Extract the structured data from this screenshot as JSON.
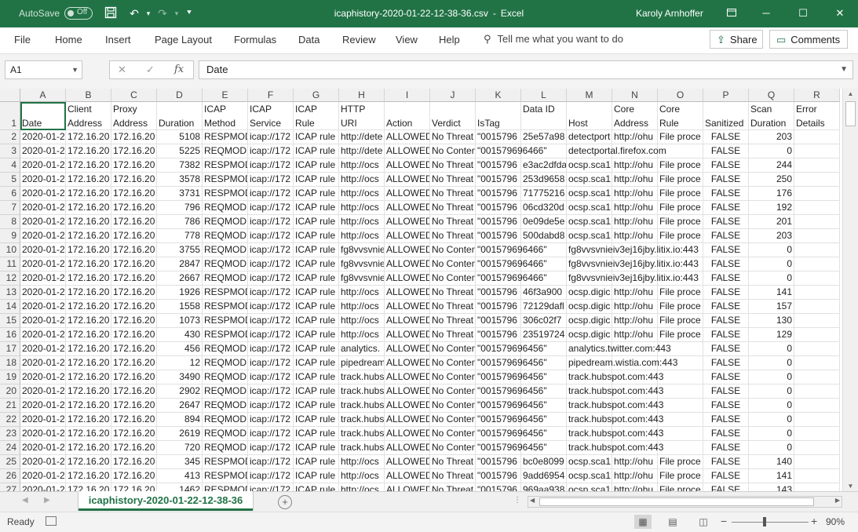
{
  "titlebar": {
    "autosave_label": "AutoSave",
    "autosave_state": "Off",
    "file_name": "icaphistory-2020-01-22-12-38-36.csv",
    "separator": "-",
    "app_name": "Excel",
    "user_name": "Karoly Arnhoffer",
    "bg_color": "#217346"
  },
  "menu": {
    "items": [
      "File",
      "Home",
      "Insert",
      "Page Layout",
      "Formulas",
      "Data",
      "Review",
      "View",
      "Help"
    ],
    "tell_me": "Tell me what you want to do",
    "share": "Share",
    "comments": "Comments"
  },
  "formula_bar": {
    "name_box": "A1",
    "fx_label": "fx",
    "content": "Date"
  },
  "grid": {
    "columns": [
      "A",
      "B",
      "C",
      "D",
      "E",
      "F",
      "G",
      "H",
      "I",
      "J",
      "K",
      "L",
      "M",
      "N",
      "O",
      "P",
      "Q",
      "R"
    ],
    "headers": [
      "Date",
      "Client Address",
      "Proxy Address",
      "Duration",
      "ICAP Method",
      "ICAP Service",
      "ICAP Rule",
      "HTTP URI",
      "Action",
      "Verdict",
      "IsTag",
      "Data ID",
      "Host",
      "Core Address",
      "Core Rule",
      "Sanitized",
      "Scan Duration",
      "Error Details"
    ],
    "rows": [
      {
        "n": "2",
        "A": "2020-01-2",
        "B": "172.16.20",
        "C": "172.16.20",
        "D": "5108",
        "E": "RESPMOD",
        "F": "icap://172",
        "G": "ICAP rule",
        "H": "http://dete",
        "I": "ALLOWED",
        "J": "No Threat",
        "K": "\"0015796",
        "L": "25e57a98",
        "M": "detectport",
        "N": "http://ohu",
        "O": "File proce",
        "P": "FALSE",
        "Q": "203",
        "R": ""
      },
      {
        "n": "3",
        "A": "2020-01-2",
        "B": "172.16.20",
        "C": "172.16.20",
        "D": "5225",
        "E": "REQMOD",
        "F": "icap://172",
        "G": "ICAP rule",
        "H": "http://dete",
        "I": "ALLOWED",
        "J": "No Conten",
        "K": "\"001579696466\"",
        "L": "",
        "M": "detectportal.firefox.com",
        "N": "",
        "O": "",
        "P": "FALSE",
        "Q": "0",
        "R": ""
      },
      {
        "n": "4",
        "A": "2020-01-2",
        "B": "172.16.20",
        "C": "172.16.20",
        "D": "7382",
        "E": "RESPMOD",
        "F": "icap://172",
        "G": "ICAP rule",
        "H": "http://ocs",
        "I": "ALLOWED",
        "J": "No Threat",
        "K": "\"0015796",
        "L": "e3ac2dfda",
        "M": "ocsp.sca1",
        "N": "http://ohu",
        "O": "File proce",
        "P": "FALSE",
        "Q": "244",
        "R": ""
      },
      {
        "n": "5",
        "A": "2020-01-2",
        "B": "172.16.20",
        "C": "172.16.20",
        "D": "3578",
        "E": "RESPMOD",
        "F": "icap://172",
        "G": "ICAP rule",
        "H": "http://ocs",
        "I": "ALLOWED",
        "J": "No Threat",
        "K": "\"0015796",
        "L": "253d9658",
        "M": "ocsp.sca1",
        "N": "http://ohu",
        "O": "File proce",
        "P": "FALSE",
        "Q": "250",
        "R": ""
      },
      {
        "n": "6",
        "A": "2020-01-2",
        "B": "172.16.20",
        "C": "172.16.20",
        "D": "3731",
        "E": "RESPMOD",
        "F": "icap://172",
        "G": "ICAP rule",
        "H": "http://ocs",
        "I": "ALLOWED",
        "J": "No Threat",
        "K": "\"0015796",
        "L": "71775216",
        "M": "ocsp.sca1",
        "N": "http://ohu",
        "O": "File proce",
        "P": "FALSE",
        "Q": "176",
        "R": ""
      },
      {
        "n": "7",
        "A": "2020-01-2",
        "B": "172.16.20",
        "C": "172.16.20",
        "D": "796",
        "E": "REQMOD",
        "F": "icap://172",
        "G": "ICAP rule",
        "H": "http://ocs",
        "I": "ALLOWED",
        "J": "No Threat",
        "K": "\"0015796",
        "L": "06cd320d",
        "M": "ocsp.sca1",
        "N": "http://ohu",
        "O": "File proce",
        "P": "FALSE",
        "Q": "192",
        "R": ""
      },
      {
        "n": "8",
        "A": "2020-01-2",
        "B": "172.16.20",
        "C": "172.16.20",
        "D": "786",
        "E": "REQMOD",
        "F": "icap://172",
        "G": "ICAP rule",
        "H": "http://ocs",
        "I": "ALLOWED",
        "J": "No Threat",
        "K": "\"0015796",
        "L": "0e09de5e",
        "M": "ocsp.sca1",
        "N": "http://ohu",
        "O": "File proce",
        "P": "FALSE",
        "Q": "201",
        "R": ""
      },
      {
        "n": "9",
        "A": "2020-01-2",
        "B": "172.16.20",
        "C": "172.16.20",
        "D": "778",
        "E": "REQMOD",
        "F": "icap://172",
        "G": "ICAP rule",
        "H": "http://ocs",
        "I": "ALLOWED",
        "J": "No Threat",
        "K": "\"0015796",
        "L": "500dabd8",
        "M": "ocsp.sca1",
        "N": "http://ohu",
        "O": "File proce",
        "P": "FALSE",
        "Q": "203",
        "R": ""
      },
      {
        "n": "10",
        "A": "2020-01-2",
        "B": "172.16.20",
        "C": "172.16.20",
        "D": "3755",
        "E": "REQMOD",
        "F": "icap://172",
        "G": "ICAP rule",
        "H": "fg8vvsvnie",
        "I": "ALLOWED",
        "J": "No Conten",
        "K": "\"001579696466\"",
        "L": "",
        "M": "fg8vvsvnieiv3ej16jby.litix.io:443",
        "N": "",
        "O": "",
        "P": "FALSE",
        "Q": "0",
        "R": ""
      },
      {
        "n": "11",
        "A": "2020-01-2",
        "B": "172.16.20",
        "C": "172.16.20",
        "D": "2847",
        "E": "REQMOD",
        "F": "icap://172",
        "G": "ICAP rule",
        "H": "fg8vvsvnie",
        "I": "ALLOWED",
        "J": "No Conten",
        "K": "\"001579696466\"",
        "L": "",
        "M": "fg8vvsvnieiv3ej16jby.litix.io:443",
        "N": "",
        "O": "",
        "P": "FALSE",
        "Q": "0",
        "R": ""
      },
      {
        "n": "12",
        "A": "2020-01-2",
        "B": "172.16.20",
        "C": "172.16.20",
        "D": "2667",
        "E": "REQMOD",
        "F": "icap://172",
        "G": "ICAP rule",
        "H": "fg8vvsvnie",
        "I": "ALLOWED",
        "J": "No Conten",
        "K": "\"001579696466\"",
        "L": "",
        "M": "fg8vvsvnieiv3ej16jby.litix.io:443",
        "N": "",
        "O": "",
        "P": "FALSE",
        "Q": "0",
        "R": ""
      },
      {
        "n": "13",
        "A": "2020-01-2",
        "B": "172.16.20",
        "C": "172.16.20",
        "D": "1926",
        "E": "RESPMOD",
        "F": "icap://172",
        "G": "ICAP rule",
        "H": "http://ocs",
        "I": "ALLOWED",
        "J": "No Threat",
        "K": "\"0015796",
        "L": "46f3a900",
        "M": "ocsp.digic",
        "N": "http://ohu",
        "O": "File proce",
        "P": "FALSE",
        "Q": "141",
        "R": ""
      },
      {
        "n": "14",
        "A": "2020-01-2",
        "B": "172.16.20",
        "C": "172.16.20",
        "D": "1558",
        "E": "RESPMOD",
        "F": "icap://172",
        "G": "ICAP rule",
        "H": "http://ocs",
        "I": "ALLOWED",
        "J": "No Threat",
        "K": "\"0015796",
        "L": "72129dafl",
        "M": "ocsp.digic",
        "N": "http://ohu",
        "O": "File proce",
        "P": "FALSE",
        "Q": "157",
        "R": ""
      },
      {
        "n": "15",
        "A": "2020-01-2",
        "B": "172.16.20",
        "C": "172.16.20",
        "D": "1073",
        "E": "RESPMOD",
        "F": "icap://172",
        "G": "ICAP rule",
        "H": "http://ocs",
        "I": "ALLOWED",
        "J": "No Threat",
        "K": "\"0015796",
        "L": "306c02f7",
        "M": "ocsp.digic",
        "N": "http://ohu",
        "O": "File proce",
        "P": "FALSE",
        "Q": "130",
        "R": ""
      },
      {
        "n": "16",
        "A": "2020-01-2",
        "B": "172.16.20",
        "C": "172.16.20",
        "D": "430",
        "E": "RESPMOD",
        "F": "icap://172",
        "G": "ICAP rule",
        "H": "http://ocs",
        "I": "ALLOWED",
        "J": "No Threat",
        "K": "\"0015796",
        "L": "23519724",
        "M": "ocsp.digic",
        "N": "http://ohu",
        "O": "File proce",
        "P": "FALSE",
        "Q": "129",
        "R": ""
      },
      {
        "n": "17",
        "A": "2020-01-2",
        "B": "172.16.20",
        "C": "172.16.20",
        "D": "456",
        "E": "REQMOD",
        "F": "icap://172",
        "G": "ICAP rule",
        "H": "analytics.",
        "I": "ALLOWED",
        "J": "No Conten",
        "K": "\"001579696456\"",
        "L": "",
        "M": "analytics.twitter.com:443",
        "N": "",
        "O": "",
        "P": "FALSE",
        "Q": "0",
        "R": ""
      },
      {
        "n": "18",
        "A": "2020-01-2",
        "B": "172.16.20",
        "C": "172.16.20",
        "D": "12",
        "E": "REQMOD",
        "F": "icap://172",
        "G": "ICAP rule",
        "H": "pipedream",
        "I": "ALLOWED",
        "J": "No Conten",
        "K": "\"001579696456\"",
        "L": "",
        "M": "pipedream.wistia.com:443",
        "N": "",
        "O": "",
        "P": "FALSE",
        "Q": "0",
        "R": ""
      },
      {
        "n": "19",
        "A": "2020-01-2",
        "B": "172.16.20",
        "C": "172.16.20",
        "D": "3490",
        "E": "REQMOD",
        "F": "icap://172",
        "G": "ICAP rule",
        "H": "track.hubs",
        "I": "ALLOWED",
        "J": "No Conten",
        "K": "\"001579696456\"",
        "L": "",
        "M": "track.hubspot.com:443",
        "N": "",
        "O": "",
        "P": "FALSE",
        "Q": "0",
        "R": ""
      },
      {
        "n": "20",
        "A": "2020-01-2",
        "B": "172.16.20",
        "C": "172.16.20",
        "D": "2902",
        "E": "REQMOD",
        "F": "icap://172",
        "G": "ICAP rule",
        "H": "track.hubs",
        "I": "ALLOWED",
        "J": "No Conten",
        "K": "\"001579696456\"",
        "L": "",
        "M": "track.hubspot.com:443",
        "N": "",
        "O": "",
        "P": "FALSE",
        "Q": "0",
        "R": ""
      },
      {
        "n": "21",
        "A": "2020-01-2",
        "B": "172.16.20",
        "C": "172.16.20",
        "D": "2647",
        "E": "REQMOD",
        "F": "icap://172",
        "G": "ICAP rule",
        "H": "track.hubs",
        "I": "ALLOWED",
        "J": "No Conten",
        "K": "\"001579696456\"",
        "L": "",
        "M": "track.hubspot.com:443",
        "N": "",
        "O": "",
        "P": "FALSE",
        "Q": "0",
        "R": ""
      },
      {
        "n": "22",
        "A": "2020-01-2",
        "B": "172.16.20",
        "C": "172.16.20",
        "D": "894",
        "E": "REQMOD",
        "F": "icap://172",
        "G": "ICAP rule",
        "H": "track.hubs",
        "I": "ALLOWED",
        "J": "No Conten",
        "K": "\"001579696456\"",
        "L": "",
        "M": "track.hubspot.com:443",
        "N": "",
        "O": "",
        "P": "FALSE",
        "Q": "0",
        "R": ""
      },
      {
        "n": "23",
        "A": "2020-01-2",
        "B": "172.16.20",
        "C": "172.16.20",
        "D": "2619",
        "E": "REQMOD",
        "F": "icap://172",
        "G": "ICAP rule",
        "H": "track.hubs",
        "I": "ALLOWED",
        "J": "No Conten",
        "K": "\"001579696456\"",
        "L": "",
        "M": "track.hubspot.com:443",
        "N": "",
        "O": "",
        "P": "FALSE",
        "Q": "0",
        "R": ""
      },
      {
        "n": "24",
        "A": "2020-01-2",
        "B": "172.16.20",
        "C": "172.16.20",
        "D": "720",
        "E": "REQMOD",
        "F": "icap://172",
        "G": "ICAP rule",
        "H": "track.hubs",
        "I": "ALLOWED",
        "J": "No Conten",
        "K": "\"001579696456\"",
        "L": "",
        "M": "track.hubspot.com:443",
        "N": "",
        "O": "",
        "P": "FALSE",
        "Q": "0",
        "R": ""
      },
      {
        "n": "25",
        "A": "2020-01-2",
        "B": "172.16.20",
        "C": "172.16.20",
        "D": "345",
        "E": "RESPMOD",
        "F": "icap://172",
        "G": "ICAP rule",
        "H": "http://ocs",
        "I": "ALLOWED",
        "J": "No Threat",
        "K": "\"0015796",
        "L": "bc0e8099",
        "M": "ocsp.sca1",
        "N": "http://ohu",
        "O": "File proce",
        "P": "FALSE",
        "Q": "140",
        "R": ""
      },
      {
        "n": "26",
        "A": "2020-01-2",
        "B": "172.16.20",
        "C": "172.16.20",
        "D": "413",
        "E": "RESPMOD",
        "F": "icap://172",
        "G": "ICAP rule",
        "H": "http://ocs",
        "I": "ALLOWED",
        "J": "No Threat",
        "K": "\"0015796",
        "L": "9add6954",
        "M": "ocsp.sca1",
        "N": "http://ohu",
        "O": "File proce",
        "P": "FALSE",
        "Q": "141",
        "R": ""
      },
      {
        "n": "27",
        "A": "2020-01-2",
        "B": "172.16.20",
        "C": "172.16.20",
        "D": "1462",
        "E": "RESPMOD",
        "F": "icap://172",
        "G": "ICAP rule",
        "H": "http://ocs",
        "I": "ALLOWED",
        "J": "No Threat",
        "K": "\"0015796",
        "L": "969aa938",
        "M": "ocsp.sca1",
        "N": "http://ohu",
        "O": "File proce",
        "P": "FALSE",
        "Q": "143",
        "R": ""
      }
    ]
  },
  "sheet_tabs": {
    "active": "icaphistory-2020-01-22-12-38-36",
    "add_label": "+"
  },
  "status": {
    "ready": "Ready",
    "zoom": "90%"
  }
}
